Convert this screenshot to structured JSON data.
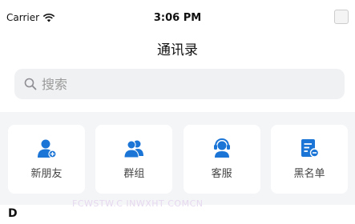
{
  "status_bar": {
    "carrier": "Carrier",
    "time": "3:06 PM"
  },
  "nav": {
    "title": "通讯录"
  },
  "search": {
    "placeholder": "搜索"
  },
  "quick_actions": [
    {
      "label": "新朋友",
      "icon": "new-friend-icon"
    },
    {
      "label": "群组",
      "icon": "group-icon"
    },
    {
      "label": "客服",
      "icon": "customer-service-icon"
    },
    {
      "label": "黑名单",
      "icon": "blacklist-icon"
    }
  ],
  "colors": {
    "accent": "#1b75d6",
    "card_bg": "#ffffff",
    "section_bg": "#f4f5f7",
    "search_bg": "#f0f1f3"
  },
  "watermark": "FCWSTW.C INWXHT COMCN",
  "contacts": {
    "section_header": "D"
  }
}
